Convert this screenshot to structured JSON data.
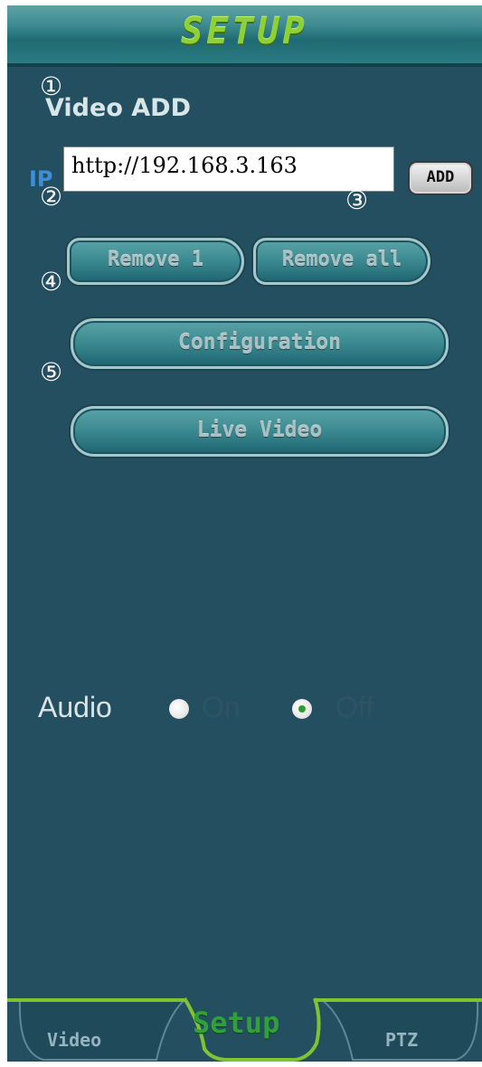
{
  "header": {
    "title": "SETUP"
  },
  "markers": [
    "①",
    "②",
    "③",
    "④",
    "⑤"
  ],
  "video_add": {
    "title": "Video ADD",
    "ip_label": "IP",
    "ip_value": "http://192.168.3.163",
    "add_label": "ADD"
  },
  "buttons": {
    "remove_one": "Remove 1",
    "remove_all": "Remove all",
    "configuration": "Configuration",
    "live_video": "Live Video"
  },
  "audio": {
    "label": "Audio",
    "on_label": "On",
    "off_label": "Off",
    "selected": "Off"
  },
  "tabs": [
    {
      "label": "Video",
      "active": false
    },
    {
      "label": "Setup",
      "active": true
    },
    {
      "label": "PTZ",
      "active": false
    }
  ],
  "colors": {
    "panel_bg": "#234f61",
    "accent_green": "#8fd037",
    "tab_active_green": "#2fa03a",
    "ip_label_blue": "#3e8fd8"
  }
}
